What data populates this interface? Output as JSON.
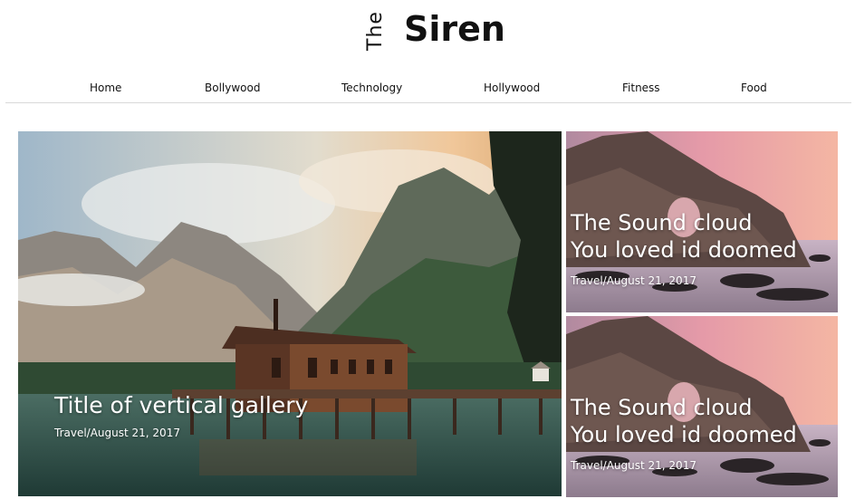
{
  "brand": {
    "the": "The",
    "name": "Siren"
  },
  "nav": {
    "items": [
      {
        "label": "Home"
      },
      {
        "label": "Bollywood"
      },
      {
        "label": "Technology"
      },
      {
        "label": "Hollywood"
      },
      {
        "label": "Fitness"
      },
      {
        "label": "Food"
      }
    ]
  },
  "featured": {
    "title": "Title of vertical gallery",
    "meta": "Travel/August 21, 2017"
  },
  "side_posts": [
    {
      "title_line1": "The Sound cloud",
      "title_line2": "You loved id doomed",
      "meta": "Travel/August 21, 2017"
    },
    {
      "title_line1": "The Sound cloud",
      "title_line2": "You loved id doomed",
      "meta": "Travel/August 21, 2017"
    }
  ]
}
